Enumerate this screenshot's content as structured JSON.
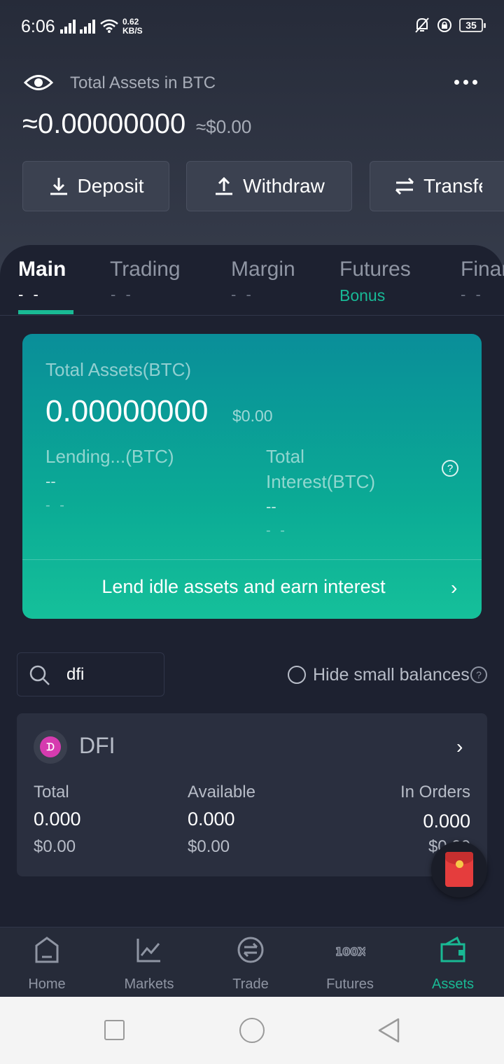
{
  "status_bar": {
    "time": "6:06",
    "net_speed_value": "0.62",
    "net_speed_unit": "KB/S",
    "battery": "35"
  },
  "header": {
    "total_assets_label": "Total Assets in BTC",
    "btc_value": "≈0.00000000",
    "usd_value": "≈$0.00",
    "actions": {
      "deposit": "Deposit",
      "withdraw": "Withdraw",
      "transfer": "Transfer"
    }
  },
  "tabs": [
    {
      "label": "Main",
      "sub": "- -"
    },
    {
      "label": "Trading",
      "sub": "- -"
    },
    {
      "label": "Margin",
      "sub": "- -"
    },
    {
      "label": "Futures",
      "sub": "Bonus"
    },
    {
      "label": "Finance",
      "sub": "- -"
    }
  ],
  "lend_card": {
    "total_label": "Total Assets(BTC)",
    "total_value": "0.00000000",
    "total_usd": "$0.00",
    "lending_label": "Lending...(BTC)",
    "lending_value": "--",
    "lending_sub": "- -",
    "interest_label_1": "Total",
    "interest_label_2": "Interest(BTC)",
    "interest_value": "--",
    "interest_sub": "- -",
    "cta": "Lend idle assets and earn interest"
  },
  "filters": {
    "search_value": "dfi",
    "hide_small_label": "Hide small balances"
  },
  "asset": {
    "name": "DFI",
    "icon_glyph": "DFI",
    "columns": [
      {
        "label": "Total",
        "value": "0.000",
        "usd": "$0.00"
      },
      {
        "label": "Available",
        "value": "0.000",
        "usd": "$0.00"
      },
      {
        "label": "In Orders",
        "value": "0.000",
        "usd": "$0.00"
      }
    ]
  },
  "bottom_nav": [
    {
      "label": "Home"
    },
    {
      "label": "Markets"
    },
    {
      "label": "Trade"
    },
    {
      "label": "Futures"
    },
    {
      "label": "Assets"
    }
  ],
  "colors": {
    "accent": "#19b994",
    "background": "#1d2130",
    "card": "#2a2f3f"
  }
}
